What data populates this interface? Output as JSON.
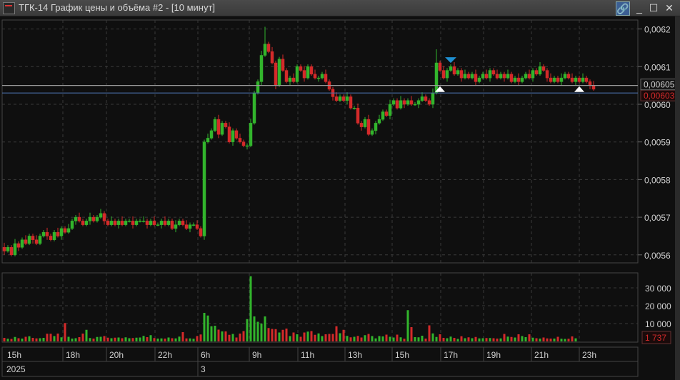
{
  "window": {
    "title": "ТГК-14 График цены и объёма #2 - [10 минут]"
  },
  "colors": {
    "up": "#32b52c",
    "down": "#d42a2a",
    "grid": "#3a3a3a",
    "last_line": "#9a9a9a",
    "level_line": "#4a6fa8",
    "marker_up": "#ffffff",
    "marker_down": "#1e8fd0"
  },
  "chart_data": {
    "type": "candlestick",
    "price_unit": 1e-06,
    "price_axis": {
      "ticks": [
        5600,
        5700,
        5800,
        5900,
        6000,
        6100,
        6200
      ],
      "labels": [
        "0,0056",
        "0,0057",
        "0,0058",
        "0,0059",
        "0,0060",
        "0,0061",
        "0,0062"
      ],
      "range": [
        5580,
        6220
      ]
    },
    "last_price_label": "0,00605",
    "last_price": 6050,
    "level_price_label": "0,00603",
    "level_price": 6030,
    "closes": [
      5610,
      5620,
      5600,
      5630,
      5620,
      5640,
      5630,
      5650,
      5640,
      5630,
      5650,
      5660,
      5650,
      5640,
      5660,
      5650,
      5670,
      5660,
      5670,
      5690,
      5700,
      5690,
      5680,
      5690,
      5700,
      5690,
      5700,
      5710,
      5690,
      5680,
      5690,
      5680,
      5690,
      5680,
      5690,
      5690,
      5680,
      5690,
      5690,
      5690,
      5680,
      5690,
      5680,
      5680,
      5690,
      5680,
      5690,
      5670,
      5680,
      5690,
      5680,
      5670,
      5680,
      5680,
      5670,
      5650,
      5900,
      5910,
      5930,
      5960,
      5920,
      5950,
      5940,
      5900,
      5930,
      5910,
      5900,
      5890,
      5890,
      5950,
      6030,
      6060,
      6130,
      6160,
      6140,
      6110,
      6050,
      6120,
      6090,
      6060,
      6070,
      6060,
      6100,
      6090,
      6070,
      6100,
      6080,
      6070,
      6070,
      6080,
      6060,
      6040,
      6020,
      6010,
      6020,
      6010,
      6020,
      5990,
      5990,
      5950,
      5940,
      5960,
      5920,
      5930,
      5950,
      5960,
      5980,
      5970,
      6000,
      6010,
      5990,
      6010,
      6000,
      6010,
      6000,
      6000,
      6010,
      6020,
      6010,
      6000,
      6030,
      6110,
      6090,
      6070,
      6090,
      6100,
      6080,
      6090,
      6070,
      6080,
      6070,
      6080,
      6060,
      6070,
      6080,
      6070,
      6090,
      6080,
      6070,
      6080,
      6070,
      6080,
      6060,
      6070,
      6060,
      6070,
      6080,
      6070,
      6090,
      6080,
      6100,
      6090,
      6070,
      6060,
      6070,
      6060,
      6070,
      6080,
      6070,
      6060,
      6070,
      6060,
      6070,
      6060,
      6050,
      6040
    ],
    "volumes": [
      2000,
      1500,
      1400,
      2500,
      1800,
      1600,
      2600,
      2900,
      2000,
      1700,
      1800,
      2000,
      4300,
      4300,
      3000,
      4400,
      2300,
      10300,
      2600,
      1600,
      1800,
      2400,
      4400,
      6500,
      1900,
      1600,
      2500,
      2600,
      3000,
      2100,
      1800,
      2100,
      2200,
      1800,
      2300,
      1800,
      1900,
      2100,
      2200,
      3100,
      2400,
      3500,
      1900,
      1600,
      1700,
      1600,
      2200,
      1800,
      1700,
      2700,
      5200,
      1700,
      1700,
      1500,
      3000,
      3900,
      16000,
      14500,
      8500,
      8800,
      6600,
      5600,
      5600,
      3700,
      4200,
      2200,
      4400,
      5800,
      12500,
      36500,
      14000,
      11000,
      10000,
      14000,
      7500,
      7000,
      6900,
      5000,
      6500,
      7200,
      3000,
      5000,
      4000,
      2600,
      5000,
      5500,
      5800,
      3700,
      4500,
      3000,
      4000,
      4200,
      4200,
      8500,
      4600,
      6500,
      3100,
      2300,
      2600,
      3100,
      2200,
      3500,
      4200,
      3000,
      1700,
      3000,
      2800,
      3800,
      2600,
      2200,
      3800,
      2300,
      1500,
      17500,
      8000,
      2400,
      2300,
      3200,
      1600,
      9000,
      4500,
      2500,
      4000,
      2000,
      1800,
      2700,
      2000,
      1400,
      2900,
      1800,
      2300,
      1800,
      2500,
      1700,
      1800,
      1900,
      1900,
      1800,
      1600,
      1700,
      4200,
      2700,
      2500,
      2200,
      4000,
      3000,
      2400,
      4000,
      2100,
      1800,
      1600,
      2200,
      1700,
      1600,
      1600,
      2600,
      1500,
      1400,
      1500,
      2800,
      1737
    ],
    "volume_axis": {
      "ticks": [
        10000,
        20000,
        30000
      ],
      "labels": [
        "10 000",
        "20 000",
        "30 000"
      ],
      "max": 38000
    },
    "last_volume_label": "1 737",
    "time_labels": [
      "15h",
      "18h",
      "20h",
      "22h",
      "6h",
      "9h",
      "11h",
      "13h",
      "15h",
      "17h",
      "19h",
      "21h",
      "23h"
    ],
    "date_labels": [
      "2025",
      "3"
    ],
    "markers": [
      {
        "type": "buy",
        "index": 122,
        "price": 6048
      },
      {
        "type": "sell",
        "index": 125,
        "price": 6106
      },
      {
        "type": "buy",
        "index": 161,
        "price": 6048
      }
    ]
  }
}
